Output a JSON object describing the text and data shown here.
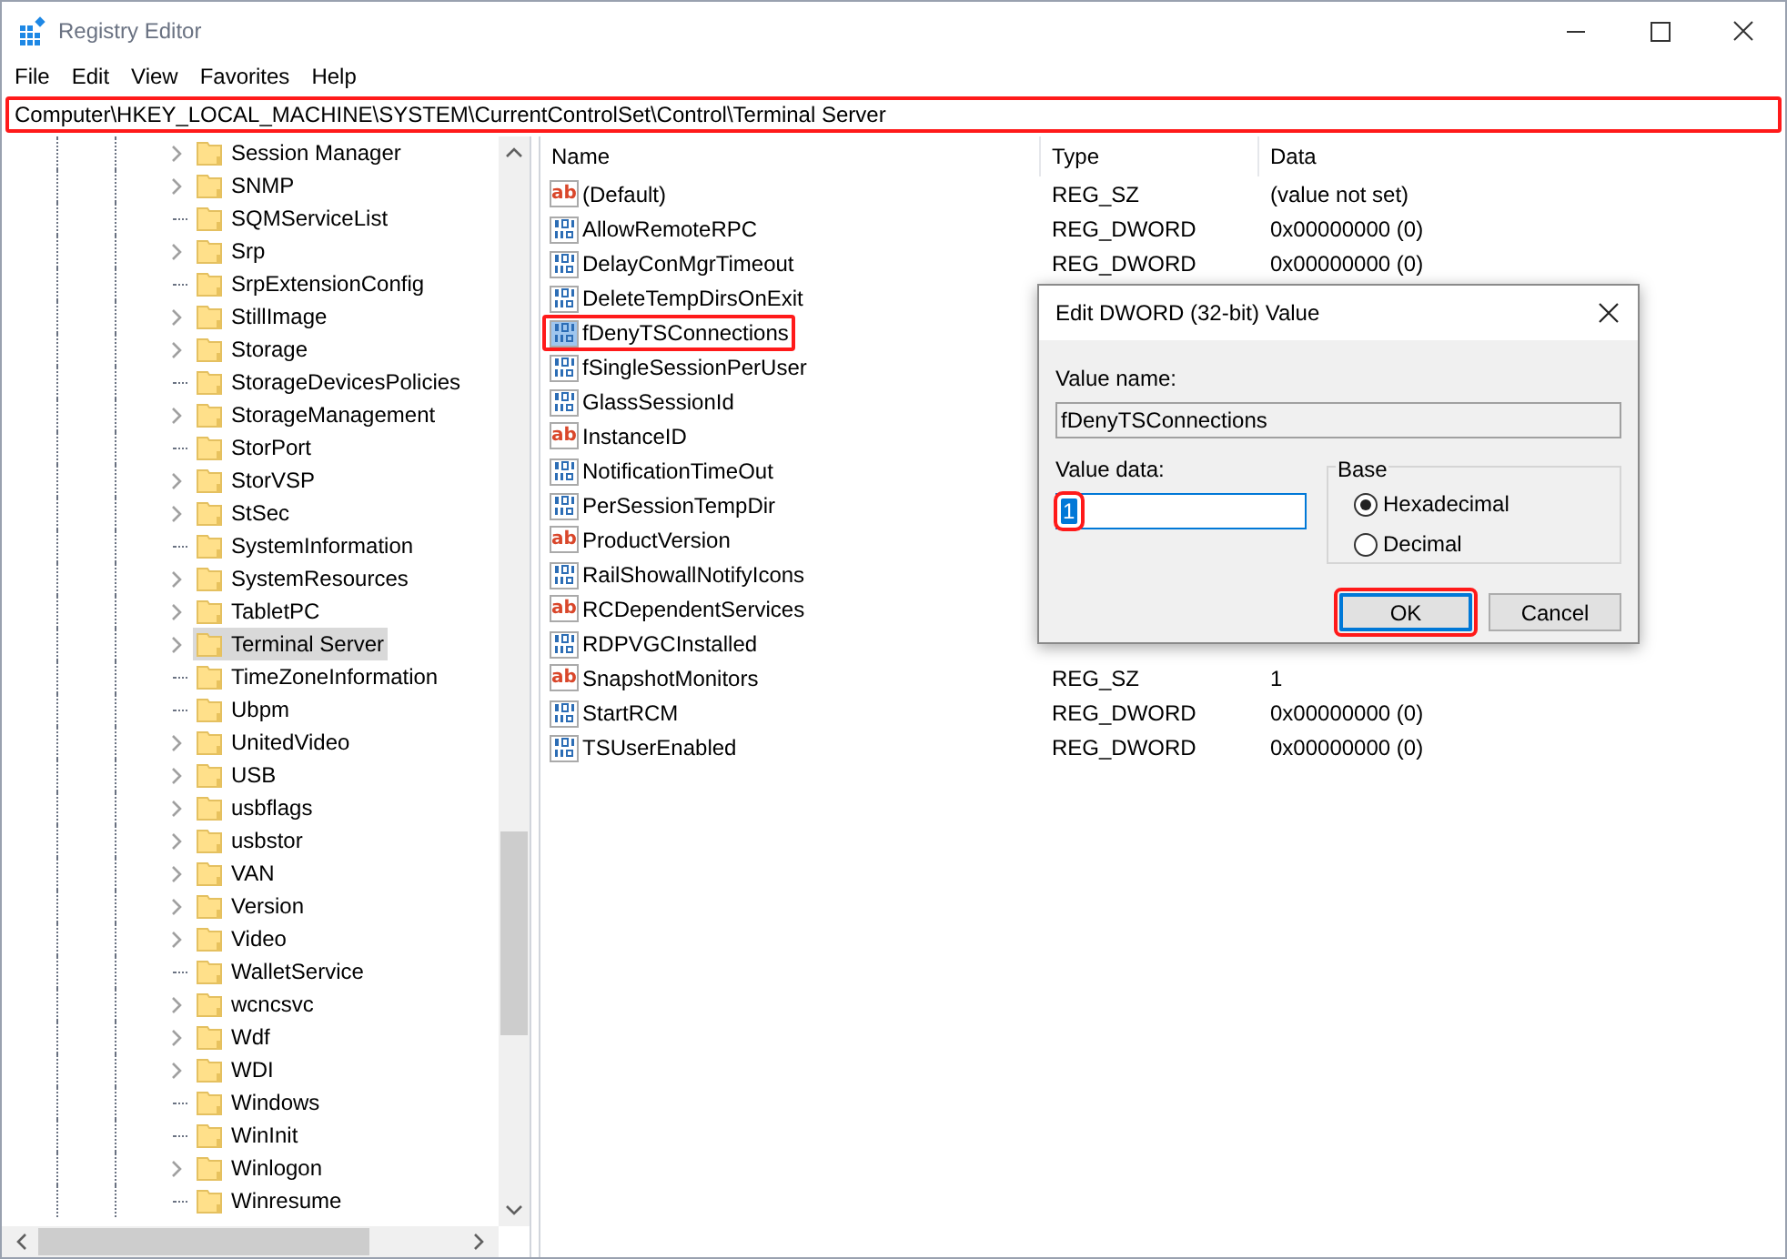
{
  "window": {
    "title": "Registry Editor"
  },
  "menu": [
    "File",
    "Edit",
    "View",
    "Favorites",
    "Help"
  ],
  "address_bar": {
    "value": "Computer\\HKEY_LOCAL_MACHINE\\SYSTEM\\CurrentControlSet\\Control\\Terminal Server",
    "highlighted": true
  },
  "tree": {
    "items": [
      {
        "label": "Session Manager",
        "expandable": true,
        "selected": false
      },
      {
        "label": "SNMP",
        "expandable": true,
        "selected": false
      },
      {
        "label": "SQMServiceList",
        "expandable": false,
        "selected": false
      },
      {
        "label": "Srp",
        "expandable": true,
        "selected": false
      },
      {
        "label": "SrpExtensionConfig",
        "expandable": false,
        "selected": false
      },
      {
        "label": "StillImage",
        "expandable": true,
        "selected": false
      },
      {
        "label": "Storage",
        "expandable": true,
        "selected": false
      },
      {
        "label": "StorageDevicesPolicies",
        "expandable": false,
        "selected": false
      },
      {
        "label": "StorageManagement",
        "expandable": true,
        "selected": false
      },
      {
        "label": "StorPort",
        "expandable": false,
        "selected": false
      },
      {
        "label": "StorVSP",
        "expandable": true,
        "selected": false
      },
      {
        "label": "StSec",
        "expandable": true,
        "selected": false
      },
      {
        "label": "SystemInformation",
        "expandable": false,
        "selected": false
      },
      {
        "label": "SystemResources",
        "expandable": true,
        "selected": false
      },
      {
        "label": "TabletPC",
        "expandable": true,
        "selected": false
      },
      {
        "label": "Terminal Server",
        "expandable": true,
        "selected": true
      },
      {
        "label": "TimeZoneInformation",
        "expandable": false,
        "selected": false
      },
      {
        "label": "Ubpm",
        "expandable": false,
        "selected": false
      },
      {
        "label": "UnitedVideo",
        "expandable": true,
        "selected": false
      },
      {
        "label": "USB",
        "expandable": true,
        "selected": false
      },
      {
        "label": "usbflags",
        "expandable": true,
        "selected": false
      },
      {
        "label": "usbstor",
        "expandable": true,
        "selected": false
      },
      {
        "label": "VAN",
        "expandable": true,
        "selected": false
      },
      {
        "label": "Version",
        "expandable": true,
        "selected": false
      },
      {
        "label": "Video",
        "expandable": true,
        "selected": false
      },
      {
        "label": "WalletService",
        "expandable": false,
        "selected": false
      },
      {
        "label": "wcncsvc",
        "expandable": true,
        "selected": false
      },
      {
        "label": "Wdf",
        "expandable": true,
        "selected": false
      },
      {
        "label": "WDI",
        "expandable": true,
        "selected": false
      },
      {
        "label": "Windows",
        "expandable": false,
        "selected": false
      },
      {
        "label": "WinInit",
        "expandable": false,
        "selected": false
      },
      {
        "label": "Winlogon",
        "expandable": true,
        "selected": false
      },
      {
        "label": "Winresume",
        "expandable": false,
        "selected": false
      }
    ]
  },
  "values_list": {
    "columns": [
      "Name",
      "Type",
      "Data"
    ],
    "rows": [
      {
        "kind": "string",
        "icon_text": "ab",
        "name": "(Default)",
        "type": "REG_SZ",
        "data": "(value not set)",
        "highlighted": false
      },
      {
        "kind": "binary",
        "name": "AllowRemoteRPC",
        "type": "REG_DWORD",
        "data": "0x00000000 (0)",
        "highlighted": false
      },
      {
        "kind": "binary",
        "name": "DelayConMgrTimeout",
        "type": "REG_DWORD",
        "data": "0x00000000 (0)",
        "highlighted": false
      },
      {
        "kind": "binary",
        "name": "DeleteTempDirsOnExit",
        "highlighted": false
      },
      {
        "kind": "binary",
        "name": "fDenyTSConnections",
        "highlighted": true
      },
      {
        "kind": "binary",
        "name": "fSingleSessionPerUser",
        "highlighted": false
      },
      {
        "kind": "binary",
        "name": "GlassSessionId",
        "highlighted": false
      },
      {
        "kind": "string",
        "icon_text": "ab",
        "name": "InstanceID",
        "highlighted": false
      },
      {
        "kind": "binary",
        "name": "NotificationTimeOut",
        "highlighted": false
      },
      {
        "kind": "binary",
        "name": "PerSessionTempDir",
        "highlighted": false
      },
      {
        "kind": "string",
        "icon_text": "ab",
        "name": "ProductVersion",
        "highlighted": false
      },
      {
        "kind": "binary",
        "name": "RailShowallNotifyIcons",
        "highlighted": false
      },
      {
        "kind": "string",
        "icon_text": "ab",
        "name": "RCDependentServices",
        "highlighted": false
      },
      {
        "kind": "binary",
        "name": "RDPVGCInstalled",
        "highlighted": false
      },
      {
        "kind": "string",
        "icon_text": "ab",
        "name": "SnapshotMonitors",
        "type": "REG_SZ",
        "data": "1",
        "highlighted": false
      },
      {
        "kind": "binary",
        "name": "StartRCM",
        "type": "REG_DWORD",
        "data": "0x00000000 (0)",
        "highlighted": false
      },
      {
        "kind": "binary",
        "name": "TSUserEnabled",
        "type": "REG_DWORD",
        "data": "0x00000000 (0)",
        "highlighted": false
      }
    ]
  },
  "dialog": {
    "title": "Edit DWORD (32-bit) Value",
    "value_name_label": "Value name:",
    "value_name": "fDenyTSConnections",
    "value_data_label": "Value data:",
    "value_data": "1",
    "value_data_highlighted": true,
    "base_label": "Base",
    "base_options": [
      {
        "label": "Hexadecimal",
        "selected": true
      },
      {
        "label": "Decimal",
        "selected": false
      }
    ],
    "buttons": [
      {
        "label": "OK",
        "default": true,
        "highlighted": true
      },
      {
        "label": "Cancel",
        "default": false,
        "highlighted": false
      }
    ]
  }
}
